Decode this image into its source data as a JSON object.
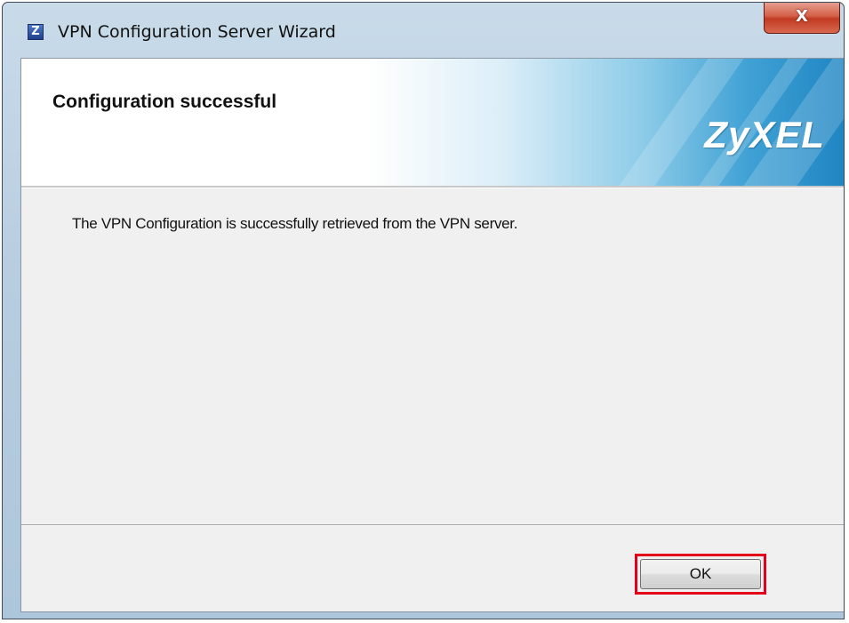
{
  "window": {
    "title": "VPN Configuration Server Wizard",
    "app_icon": "zyxel-z-icon",
    "app_icon_glyph": "Z",
    "close_glyph": "X"
  },
  "header": {
    "title": "Configuration successful",
    "logo_text": "ZyXEL"
  },
  "body": {
    "message": "The VPN Configuration is successfully retrieved from the VPN server."
  },
  "footer": {
    "ok_label": "OK",
    "highlight_color": "#e3001b"
  },
  "colors": {
    "close_button": "#c13a22",
    "banner_blue": "#1f85c3"
  }
}
